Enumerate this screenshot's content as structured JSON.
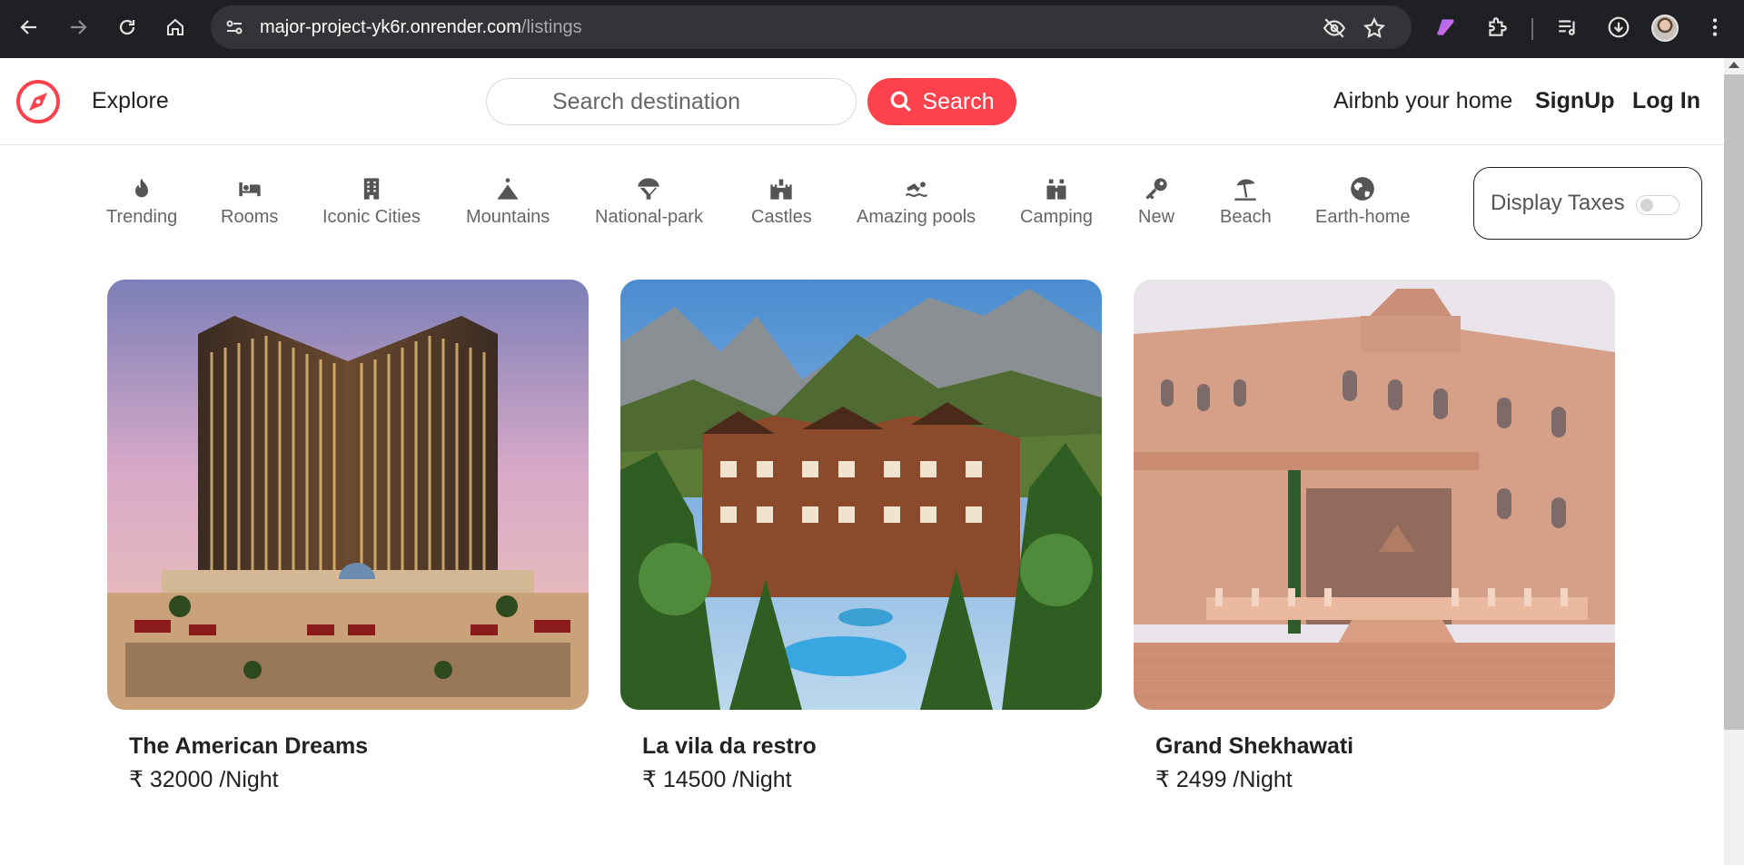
{
  "browser": {
    "url_host": "major-project-yk6r.onrender.com",
    "url_path": "/listings"
  },
  "site": {
    "explore_label": "Explore",
    "search_placeholder": "Search destination",
    "search_button_label": "Search",
    "airbnb_home_label": "Airbnb your home",
    "signup_label": "SignUp",
    "login_label": "Log In",
    "accent_color": "#fe424d"
  },
  "filters": [
    {
      "label": "Trending",
      "icon": "fire-icon"
    },
    {
      "label": "Rooms",
      "icon": "bed-icon"
    },
    {
      "label": "Iconic Cities",
      "icon": "building-icon"
    },
    {
      "label": "Mountains",
      "icon": "mountain-icon"
    },
    {
      "label": "National-park",
      "icon": "parachute-icon"
    },
    {
      "label": "Castles",
      "icon": "castle-icon"
    },
    {
      "label": "Amazing pools",
      "icon": "swimmer-icon"
    },
    {
      "label": "Camping",
      "icon": "binoculars-icon"
    },
    {
      "label": "New",
      "icon": "key-icon"
    },
    {
      "label": "Beach",
      "icon": "umbrella-beach-icon"
    },
    {
      "label": "Earth-home",
      "icon": "globe-icon"
    }
  ],
  "tax_toggle": {
    "label": "Display Taxes",
    "enabled": false
  },
  "listings": [
    {
      "title": "The American Dreams",
      "price": "₹ 32000 /Night"
    },
    {
      "title": "La vila da restro",
      "price": "₹ 14500 /Night"
    },
    {
      "title": "Grand Shekhawati",
      "price": "₹ 2499 /Night"
    }
  ]
}
